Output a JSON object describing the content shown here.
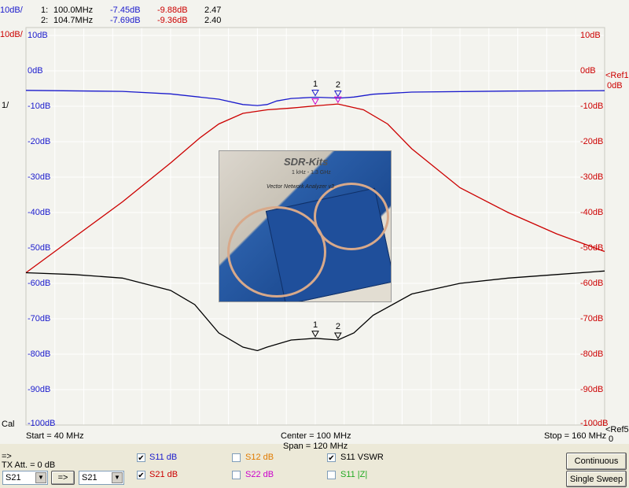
{
  "marker_table": {
    "scale_label": "10dB/",
    "rows": [
      {
        "id": "1:",
        "freq": "100.0MHz",
        "s11": "-7.45dB",
        "s21": "-9.88dB",
        "vswr": "2.47"
      },
      {
        "id": "2:",
        "freq": "104.7MHz",
        "s11": "-7.69dB",
        "s21": "-9.36dB",
        "vswr": "2.40"
      }
    ]
  },
  "left_labels": {
    "scale_red": "10dB/",
    "vswr_scale": "1/",
    "cal": "Cal"
  },
  "y_axis_labels": [
    "10dB",
    "0dB",
    "-10dB",
    "-20dB",
    "-30dB",
    "-40dB",
    "-50dB",
    "-60dB",
    "-70dB",
    "-80dB",
    "-90dB",
    "-100dB"
  ],
  "right_labels": {
    "ref1": "<Ref1",
    "ref1_val": "0dB",
    "ref5": "<Ref5",
    "ref5_val": "0"
  },
  "marker_labels": [
    "1",
    "2"
  ],
  "photo": {
    "brand": "SDR-Kits",
    "sub": "1 kHz - 1.3 GHz",
    "vna": "Vector Network Analyzer v3"
  },
  "freq_info": {
    "start": "Start = 40 MHz",
    "center": "Center = 100 MHz",
    "span": "Span = 120 MHz",
    "stop": "Stop = 160 MHz"
  },
  "controls": {
    "arrow_label": "=>",
    "tx_att": "TX Att. = 0 dB",
    "select1_value": "S21",
    "select2_value": "S21",
    "transfer_button": "=>",
    "checkboxes": [
      {
        "label": "S11  dB",
        "checked": true,
        "color": "#1a1acc"
      },
      {
        "label": "S21  dB",
        "checked": true,
        "color": "#cc0000"
      },
      {
        "label": "S12  dB",
        "checked": false,
        "color": "#e07b00"
      },
      {
        "label": "S22  dB",
        "checked": false,
        "color": "#cc00cc"
      },
      {
        "label": "S11  VSWR",
        "checked": true,
        "color": "#000000"
      },
      {
        "label": "S11  |Z|",
        "checked": false,
        "color": "#22aa22"
      }
    ],
    "continuous_button": "Continuous",
    "single_sweep_button": "Single Sweep"
  },
  "chart_data": {
    "type": "line",
    "x_unit": "MHz",
    "xlim": [
      40,
      160
    ],
    "ylim": [
      -100,
      10
    ],
    "grid": true,
    "series": [
      {
        "name": "S11 dB",
        "color": "#1a1acc",
        "x": [
          40,
          60,
          70,
          80,
          85,
          88,
          90,
          92,
          95,
          100,
          105,
          108,
          112,
          120,
          140,
          160
        ],
        "y": [
          -5.5,
          -5.8,
          -6.5,
          -8,
          -9.5,
          -9.8,
          -9.5,
          -8.5,
          -7.8,
          -7.45,
          -7.69,
          -7.4,
          -6.6,
          -6.0,
          -5.7,
          -5.6
        ]
      },
      {
        "name": "S21 dB",
        "color": "#cc0000",
        "x": [
          40,
          50,
          60,
          70,
          76,
          80,
          85,
          90,
          95,
          100,
          104.7,
          110,
          115,
          120,
          130,
          140,
          150,
          160
        ],
        "y": [
          -57,
          -47,
          -37,
          -26,
          -19,
          -15,
          -12,
          -11,
          -10.5,
          -9.88,
          -9.36,
          -11,
          -15,
          -22,
          -33,
          -40,
          -46,
          -51
        ]
      },
      {
        "name": "S11 VSWR",
        "color": "#000000",
        "x": [
          40,
          50,
          60,
          70,
          75,
          80,
          85,
          88,
          90,
          95,
          100,
          104.7,
          108,
          112,
          120,
          130,
          140,
          150,
          160
        ],
        "y": [
          -57,
          -57.5,
          -58.5,
          -62,
          -66,
          -74,
          -78,
          -79,
          -78,
          -76,
          -75.5,
          -76,
          -74,
          -69,
          -63,
          -60,
          -58.5,
          -57.5,
          -56.5
        ]
      }
    ],
    "markers": [
      {
        "label": "1",
        "x": 100
      },
      {
        "label": "2",
        "x": 104.7
      }
    ]
  }
}
